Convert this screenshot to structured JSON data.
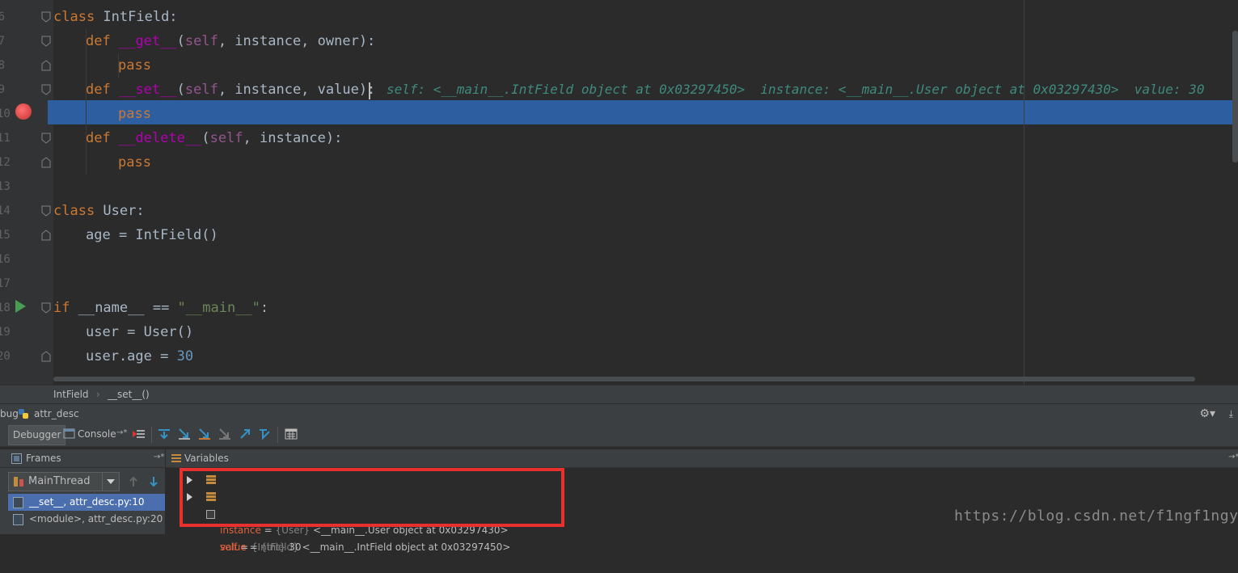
{
  "editor": {
    "line_numbers": [
      "6",
      "7",
      "8",
      "9",
      "10",
      "11",
      "12",
      "13",
      "14",
      "15",
      "16",
      "17",
      "18",
      "19",
      "20"
    ],
    "code": {
      "l6": {
        "kw": "class",
        "rest": " IntField:"
      },
      "l7": {
        "kw": "def",
        "name": "__get__",
        "open": "(",
        "self": "self",
        "args": ", instance, owner):"
      },
      "l8": {
        "kw": "pass"
      },
      "l9": {
        "kw": "def",
        "name": "__set__",
        "open": "(",
        "self": "self",
        "args": ", instance, value):"
      },
      "l10": {
        "kw": "pass"
      },
      "l11": {
        "kw": "def",
        "name": "__delete__",
        "open": "(",
        "self": "self",
        "args": ", instance):"
      },
      "l12": {
        "kw": "pass"
      },
      "l14": {
        "kw": "class",
        "rest": " User:"
      },
      "l15": {
        "text": "age = IntField()"
      },
      "l18": {
        "kw": "if",
        "pre": " __name__ == ",
        "str": "\"__main__\"",
        "post": ":"
      },
      "l19": {
        "text": "user = User()"
      },
      "l20": {
        "text": "user.age = ",
        "num": "30"
      }
    },
    "inline_hint": "self: <__main__.IntField object at 0x03297450>  instance: <__main__.User object at 0x03297430>  value: 30"
  },
  "breadcrumb": {
    "items": [
      "IntField",
      "__set__()"
    ],
    "separator": "›"
  },
  "debug_window": {
    "title_prefix": "bug",
    "config_name": "attr_desc"
  },
  "toolbar": {
    "tab_debugger": "Debugger",
    "tab_console": "Console",
    "pin": "→*"
  },
  "frames_panel": {
    "title": "Frames",
    "thread": "MainThread",
    "frames": [
      "__set__, attr_desc.py:10",
      "<module>, attr_desc.py:20"
    ]
  },
  "variables_panel": {
    "title": "Variables",
    "variables": [
      {
        "name": "instance",
        "type": "{User}",
        "value": "<__main__.User object at 0x03297430>"
      },
      {
        "name": "self",
        "type": "{IntField}",
        "value": "<__main__.IntField object at 0x03297450>"
      },
      {
        "name": "value",
        "type": "{int}",
        "value": "30"
      }
    ]
  },
  "watermark": "https://blog.csdn.net/f1ngf1ngy1ng",
  "colors": {
    "highlight": "#2d5fa0",
    "keyword": "#cc7832",
    "magic": "#b200b2",
    "annotation": "#e8312f"
  }
}
